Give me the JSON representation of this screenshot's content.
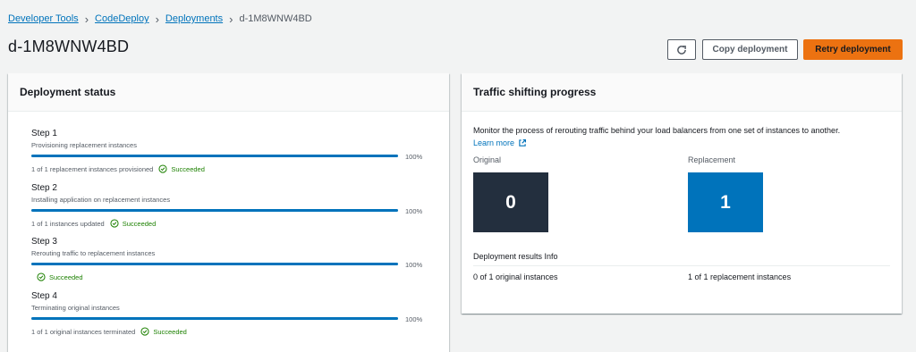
{
  "breadcrumb": {
    "items": [
      "Developer Tools",
      "CodeDeploy",
      "Deployments"
    ],
    "current": "d-1M8WNW4BD"
  },
  "page_title": "d-1M8WNW4BD",
  "header_actions": {
    "refresh_icon": "refresh-icon",
    "copy_label": "Copy deployment",
    "retry_label": "Retry deployment",
    "retry_color": "#ec7211"
  },
  "deployment_status": {
    "title": "Deployment status",
    "steps": [
      {
        "title": "Step 1",
        "description": "Provisioning replacement instances",
        "progress": 100,
        "progress_label": "100%",
        "detail": "1 of 1 replacement instances provisioned",
        "status": "Succeeded"
      },
      {
        "title": "Step 2",
        "description": "Installing application on replacement instances",
        "progress": 100,
        "progress_label": "100%",
        "detail": "1 of 1 instances updated",
        "status": "Succeeded"
      },
      {
        "title": "Step 3",
        "description": "Rerouting traffic to replacement instances",
        "progress": 100,
        "progress_label": "100%",
        "detail": "",
        "status": "Succeeded"
      },
      {
        "title": "Step 4",
        "description": "Terminating original instances",
        "progress": 100,
        "progress_label": "100%",
        "detail": "1 of 1 original instances terminated",
        "status": "Succeeded"
      }
    ]
  },
  "traffic_shifting": {
    "title": "Traffic shifting progress",
    "description": "Monitor the process of rerouting traffic behind your load balancers from one set of instances to another.",
    "learn_more": "Learn more",
    "original_label": "Original",
    "original_value": "0",
    "original_color": "#232f3e",
    "replacement_label": "Replacement",
    "replacement_value": "1",
    "replacement_color": "#0073bb",
    "results_header": "Deployment results Info",
    "original_result": "0 of 1 original instances",
    "replacement_result": "1 of 1 replacement instances"
  }
}
